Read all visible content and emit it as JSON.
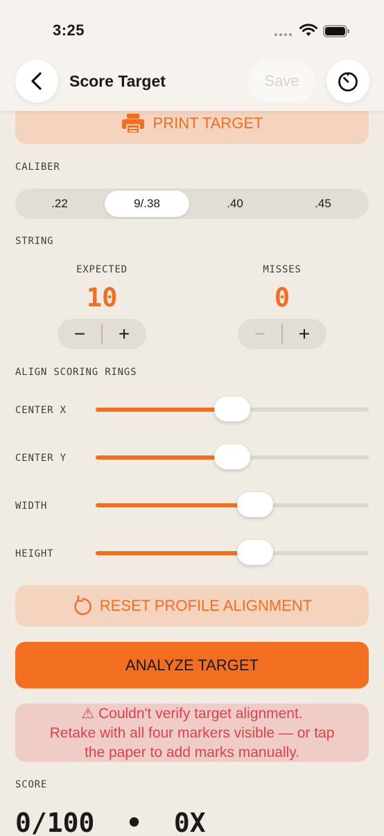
{
  "status": {
    "time": "3:25"
  },
  "nav": {
    "title": "Score Target",
    "save_label": "Save"
  },
  "print_button": {
    "label": "PRINT TARGET"
  },
  "caliber": {
    "label": "CALIBER",
    "options": [
      ".22",
      "9/.38",
      ".40",
      ".45"
    ],
    "selected": "9/.38"
  },
  "string": {
    "label": "STRING",
    "expected": {
      "label": "EXPECTED",
      "value": "10",
      "minus": "−",
      "plus": "+"
    },
    "misses": {
      "label": "MISSES",
      "value": "0",
      "minus": "−",
      "plus": "+",
      "minus_disabled": true
    }
  },
  "align": {
    "label": "ALIGN SCORING RINGS",
    "sliders": [
      {
        "label": "CENTER X",
        "value": 0.5
      },
      {
        "label": "CENTER Y",
        "value": 0.5
      },
      {
        "label": "WIDTH",
        "value": 0.585
      },
      {
        "label": "HEIGHT",
        "value": 0.585
      }
    ]
  },
  "reset_button": {
    "label": "RESET PROFILE ALIGNMENT"
  },
  "analyze_button": {
    "label": "ANALYZE TARGET"
  },
  "alert": {
    "line1": "⚠ Couldn't verify target alignment.",
    "line2": "Retake with all four markers visible — or tap",
    "line3": "the paper to add marks manually."
  },
  "score": {
    "label": "SCORE",
    "value": "0/100",
    "separator": "•",
    "x_count": "0X"
  },
  "colors": {
    "accent": "#f26f22",
    "accent_light": "#f4d4bf",
    "alert_bg": "#f0ccc6",
    "alert_text": "#e2404a",
    "background": "#f0ece4"
  }
}
